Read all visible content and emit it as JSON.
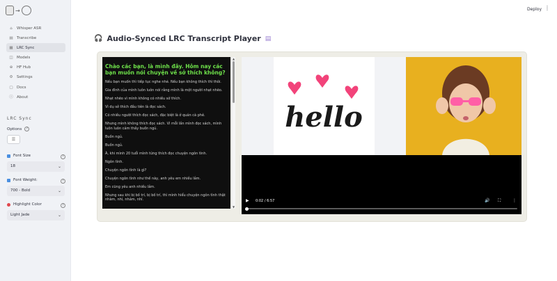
{
  "nav": [
    {
      "label": "Whisper ASR",
      "icon": "home-icon",
      "glyph": "⌂"
    },
    {
      "label": "Transcribe",
      "icon": "document-icon",
      "glyph": "▤"
    },
    {
      "label": "LRC Sync",
      "icon": "sync-icon",
      "glyph": "▦",
      "active": true
    },
    {
      "label": "Models",
      "icon": "cube-icon",
      "glyph": "◫"
    },
    {
      "label": "HF Hub",
      "icon": "hub-icon",
      "glyph": "⊕"
    },
    {
      "label": "Settings",
      "icon": "gear-icon",
      "glyph": "⚙"
    },
    {
      "label": "Docs",
      "icon": "book-icon",
      "glyph": "▢"
    },
    {
      "label": "About",
      "icon": "info-icon",
      "glyph": "ⓘ"
    }
  ],
  "sidebar": {
    "section_title": "LRC Sync",
    "options_label": "Options",
    "font_size": {
      "label": "Font Size",
      "value": "18",
      "color": "#4a8fe0"
    },
    "font_weight": {
      "label": "Font Weight:",
      "value": "700 - Bold",
      "color": "#4a8fe0"
    },
    "highlight_color": {
      "label": "Highlight Color",
      "value": "Light Jade",
      "color": "#e0474c"
    }
  },
  "header": {
    "deploy_label": "Deploy",
    "menu_glyph": "⋮"
  },
  "page": {
    "title": "Audio-Synced LRC Transcript Player",
    "title_icon": "headphones-icon",
    "title_trailing_icon": "scroll-icon"
  },
  "lyrics": {
    "current": "Chào các bạn, là mình đây. Hôm nay các bạn muốn nói chuyện về sở thích không?",
    "lines": [
      "Nếu bạn muốn thì tiếp tục nghe nhé. Nếu bạn không thích thì thôi.",
      "Gia đình của mình luôn luôn nói rằng mình là một người nhạt nhẽo.",
      "Nhạt nhẽo vì mình không có nhiều sở thích.",
      "Vì dụ sở thích đầu tiên là đọc sách.",
      "Có nhiều người thích đọc sách, đặc biệt là ở quán cà phê.",
      "Nhưng mình không thích đọc sách. Vì mỗi lần mình đọc sách, mình luôn luôn cảm thấy buồn ngủ.",
      "Buồn ngủ.",
      "Buồn ngủ.",
      "À, khi mình 20 tuổi mình từng thích đọc chuyện ngôn tình.",
      "Ngôn tình.",
      "Chuyện ngôn tình là gì?",
      "Chuyện ngôn tình như thế này, anh yêu em nhiều lắm.",
      "Em cũng yêu anh nhiều lắm.",
      "Nhưng sau khi bị bố trí, bị bố trí, thì mình hiểu chuyện ngôn tình thật nhàm, nhí, nhảm, nhí."
    ]
  },
  "video": {
    "time": "0:02 / 6:57",
    "progress": 0.005,
    "hello_text": "hello",
    "left_bg": "#f2f3f6",
    "right_bg": "#e8b01f"
  }
}
